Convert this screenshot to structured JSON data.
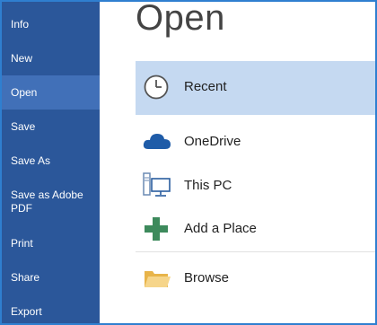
{
  "sidebar": {
    "items": [
      {
        "label": "Info"
      },
      {
        "label": "New"
      },
      {
        "label": "Open"
      },
      {
        "label": "Save"
      },
      {
        "label": "Save As"
      },
      {
        "label": "Save as Adobe\nPDF"
      },
      {
        "label": "Print"
      },
      {
        "label": "Share"
      },
      {
        "label": "Export"
      }
    ],
    "active": "Open"
  },
  "main": {
    "title": "Open",
    "places": [
      {
        "label": "Recent",
        "icon": "clock-icon",
        "selected": true
      },
      {
        "label": "OneDrive",
        "icon": "cloud-icon",
        "selected": false
      },
      {
        "label": "This PC",
        "icon": "computer-icon",
        "selected": false
      },
      {
        "label": "Add a Place",
        "icon": "plus-icon",
        "selected": false
      },
      {
        "label": "Browse",
        "icon": "folder-icon",
        "selected": false
      }
    ]
  },
  "colors": {
    "sidebar_bg": "#2b579a",
    "sidebar_active": "#4170b8",
    "selected_row": "#c5d9f1",
    "frame_border": "#2f7fd0"
  }
}
